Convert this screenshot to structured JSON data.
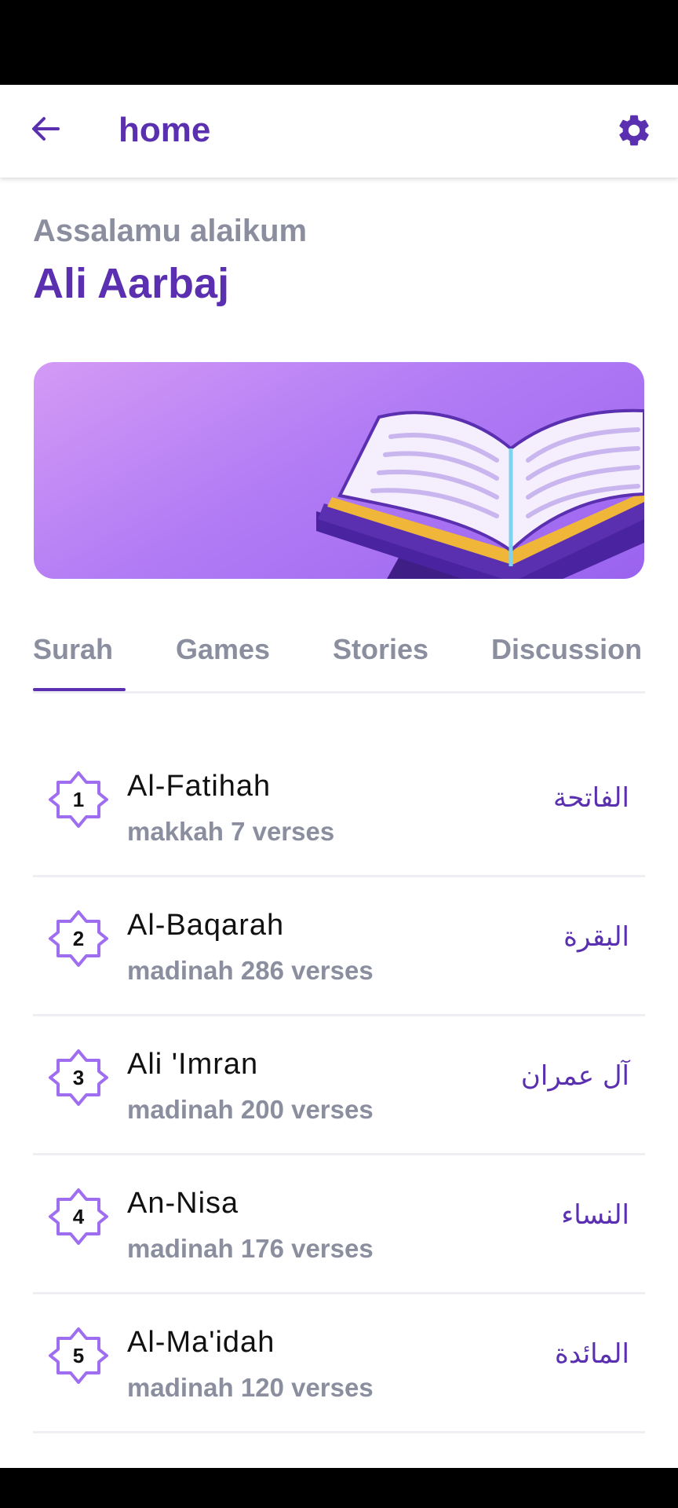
{
  "app_bar": {
    "title": "home",
    "back_icon": "arrow-left-icon",
    "settings_icon": "gear-icon"
  },
  "greeting": {
    "salutation": "Assalamu alaikum",
    "user_name": "Ali Aarbaj"
  },
  "banner": {
    "illustration": "open-quran-book-icon"
  },
  "tabs": [
    {
      "label": "Surah",
      "active": true
    },
    {
      "label": "Games",
      "active": false
    },
    {
      "label": "Stories",
      "active": false
    },
    {
      "label": "Discussion",
      "active": false
    }
  ],
  "surahs": [
    {
      "number": "1",
      "name": "Al-Fatihah",
      "meta": "makkah 7 verses",
      "arabic": "الفاتحة"
    },
    {
      "number": "2",
      "name": "Al-Baqarah",
      "meta": "madinah 286 verses",
      "arabic": "البقرة"
    },
    {
      "number": "3",
      "name": "Ali 'Imran",
      "meta": "madinah 200 verses",
      "arabic": "آل عمران"
    },
    {
      "number": "4",
      "name": "An-Nisa",
      "meta": "madinah 176 verses",
      "arabic": "النساء"
    },
    {
      "number": "5",
      "name": "Al-Ma'idah",
      "meta": "madinah 120 verses",
      "arabic": "المائدة"
    }
  ],
  "colors": {
    "primary": "#5a2fb0",
    "muted": "#8a8e9e",
    "badge_stroke": "#9f6ef0"
  }
}
